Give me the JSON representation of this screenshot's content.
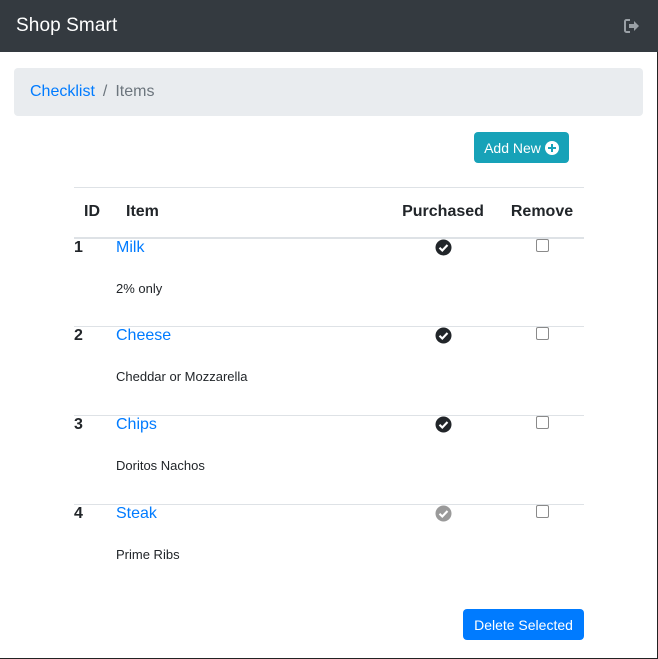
{
  "navbar": {
    "brand": "Shop Smart",
    "logout_icon": "sign-out-icon",
    "colors": {
      "background": "#343a40",
      "text": "#ffffff"
    }
  },
  "breadcrumb": {
    "link": "Checklist",
    "separator": "/",
    "active": "Items"
  },
  "actions": {
    "add_label": "Add New",
    "add_icon": "plus-circle-icon",
    "delete_label": "Delete Selected",
    "colors": {
      "add": "#17a2b8",
      "delete": "#007bff"
    }
  },
  "table": {
    "headers": {
      "id": "ID",
      "item": "Item",
      "purchased": "Purchased",
      "remove": "Remove"
    },
    "rows": [
      {
        "id": "1",
        "name": "Milk",
        "note": "2% only",
        "purchased": true,
        "remove": false
      },
      {
        "id": "2",
        "name": "Cheese",
        "note": "Cheddar or Mozzarella",
        "purchased": true,
        "remove": false
      },
      {
        "id": "3",
        "name": "Chips",
        "note": "Doritos Nachos",
        "purchased": true,
        "remove": false
      },
      {
        "id": "4",
        "name": "Steak",
        "note": "Prime Ribs",
        "purchased": false,
        "remove": false
      }
    ],
    "colors": {
      "link": "#007bff",
      "purchased_icon": "#212529",
      "not_purchased_icon": "#9a9a9a"
    }
  }
}
